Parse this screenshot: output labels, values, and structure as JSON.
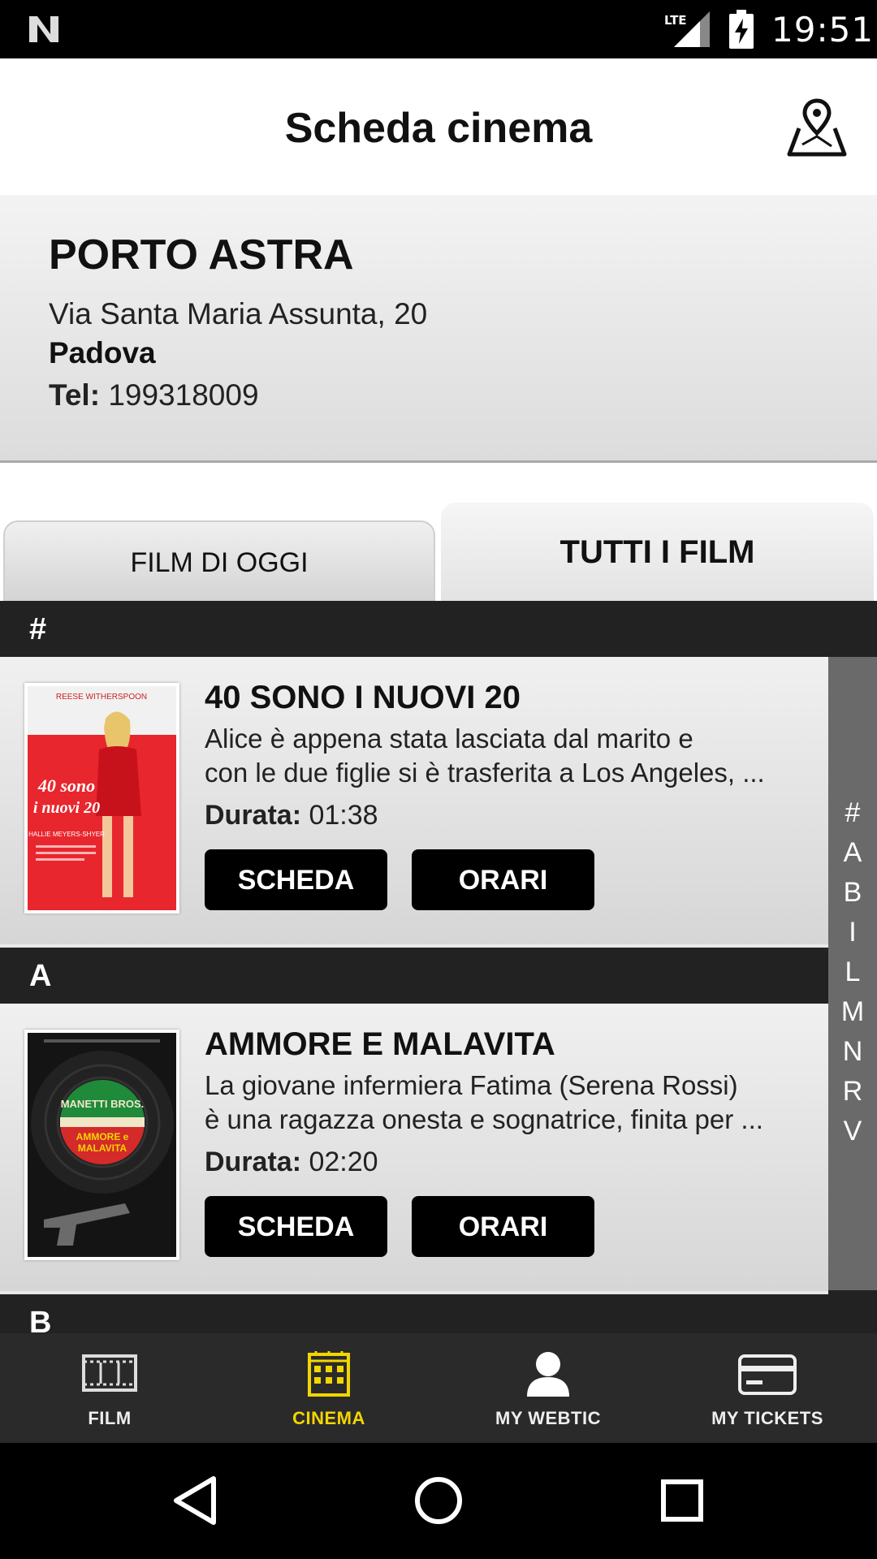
{
  "status_bar": {
    "time": "19:51",
    "network": "LTE"
  },
  "header": {
    "title": "Scheda cinema"
  },
  "cinema": {
    "name": "PORTO ASTRA",
    "address": "Via Santa Maria Assunta, 20",
    "city": "Padova",
    "tel_label": "Tel:",
    "tel_value": "199318009"
  },
  "tabs": [
    {
      "label": "FILM DI OGGI",
      "active": false
    },
    {
      "label": "TUTTI I FILM",
      "active": true
    }
  ],
  "sections": [
    {
      "letter": "#",
      "film": {
        "title": "40 SONO I NUOVI 20",
        "desc_line1": "Alice è appena stata lasciata dal marito e",
        "desc_line2": "con le due figlie si è trasferita a Los Angeles, ...",
        "duration_label": "Durata:",
        "duration": "01:38",
        "poster_top": "REESE WITHERSPOON",
        "poster_title": "40 sono i nuovi 20",
        "poster_sub": "HALLIE MEYERS-SHYER"
      }
    },
    {
      "letter": "A",
      "film": {
        "title": "AMMORE E MALAVITA",
        "desc_line1": "La giovane infermiera Fatima (Serena Rossi)",
        "desc_line2": "è una ragazza onesta e sognatrice, finita per ...",
        "duration_label": "Durata:",
        "duration": "02:20",
        "poster_top": "MANETTI BROS.",
        "poster_title": "AMMORE e MALAVITA",
        "poster_sub": ""
      }
    },
    {
      "letter": "B"
    }
  ],
  "buttons": {
    "scheda": "SCHEDA",
    "orari": "ORARI"
  },
  "index_letters": [
    "#",
    "A",
    "B",
    "I",
    "L",
    "M",
    "N",
    "R",
    "V"
  ],
  "bottom_nav": [
    {
      "label": "FILM",
      "icon": "film-strip-icon",
      "active": false
    },
    {
      "label": "CINEMA",
      "icon": "cinema-building-icon",
      "active": true
    },
    {
      "label": "MY WEBTIC",
      "icon": "user-icon",
      "active": false
    },
    {
      "label": "MY TICKETS",
      "icon": "credit-card-icon",
      "active": false
    }
  ],
  "colors": {
    "active_nav": "#f2d600",
    "section_header": "#222222",
    "button": "#000000"
  }
}
